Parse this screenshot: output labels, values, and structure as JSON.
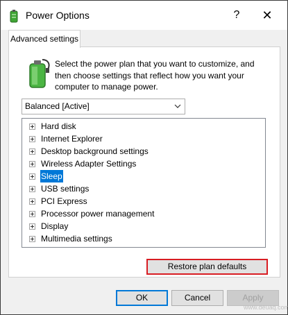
{
  "window": {
    "title": "Power Options",
    "help_glyph": "?",
    "close_glyph": "✕"
  },
  "tabs": [
    {
      "label": "Advanced settings",
      "active": true
    }
  ],
  "description": "Select the power plan that you want to customize, and then choose settings that reflect how you want your computer to manage power.",
  "plan_select": {
    "value": "Balanced [Active]"
  },
  "settings_tree": {
    "items": [
      {
        "label": "Hard disk",
        "selected": false
      },
      {
        "label": "Internet Explorer",
        "selected": false
      },
      {
        "label": "Desktop background settings",
        "selected": false
      },
      {
        "label": "Wireless Adapter Settings",
        "selected": false
      },
      {
        "label": "Sleep",
        "selected": true
      },
      {
        "label": "USB settings",
        "selected": false
      },
      {
        "label": "PCI Express",
        "selected": false
      },
      {
        "label": "Processor power management",
        "selected": false
      },
      {
        "label": "Display",
        "selected": false
      },
      {
        "label": "Multimedia settings",
        "selected": false
      }
    ]
  },
  "buttons": {
    "restore": "Restore plan defaults",
    "ok": "OK",
    "cancel": "Cancel",
    "apply": "Apply"
  },
  "watermark": "www.deuaq.com",
  "colors": {
    "selection": "#0078d7",
    "highlight_border": "#d81c22"
  }
}
